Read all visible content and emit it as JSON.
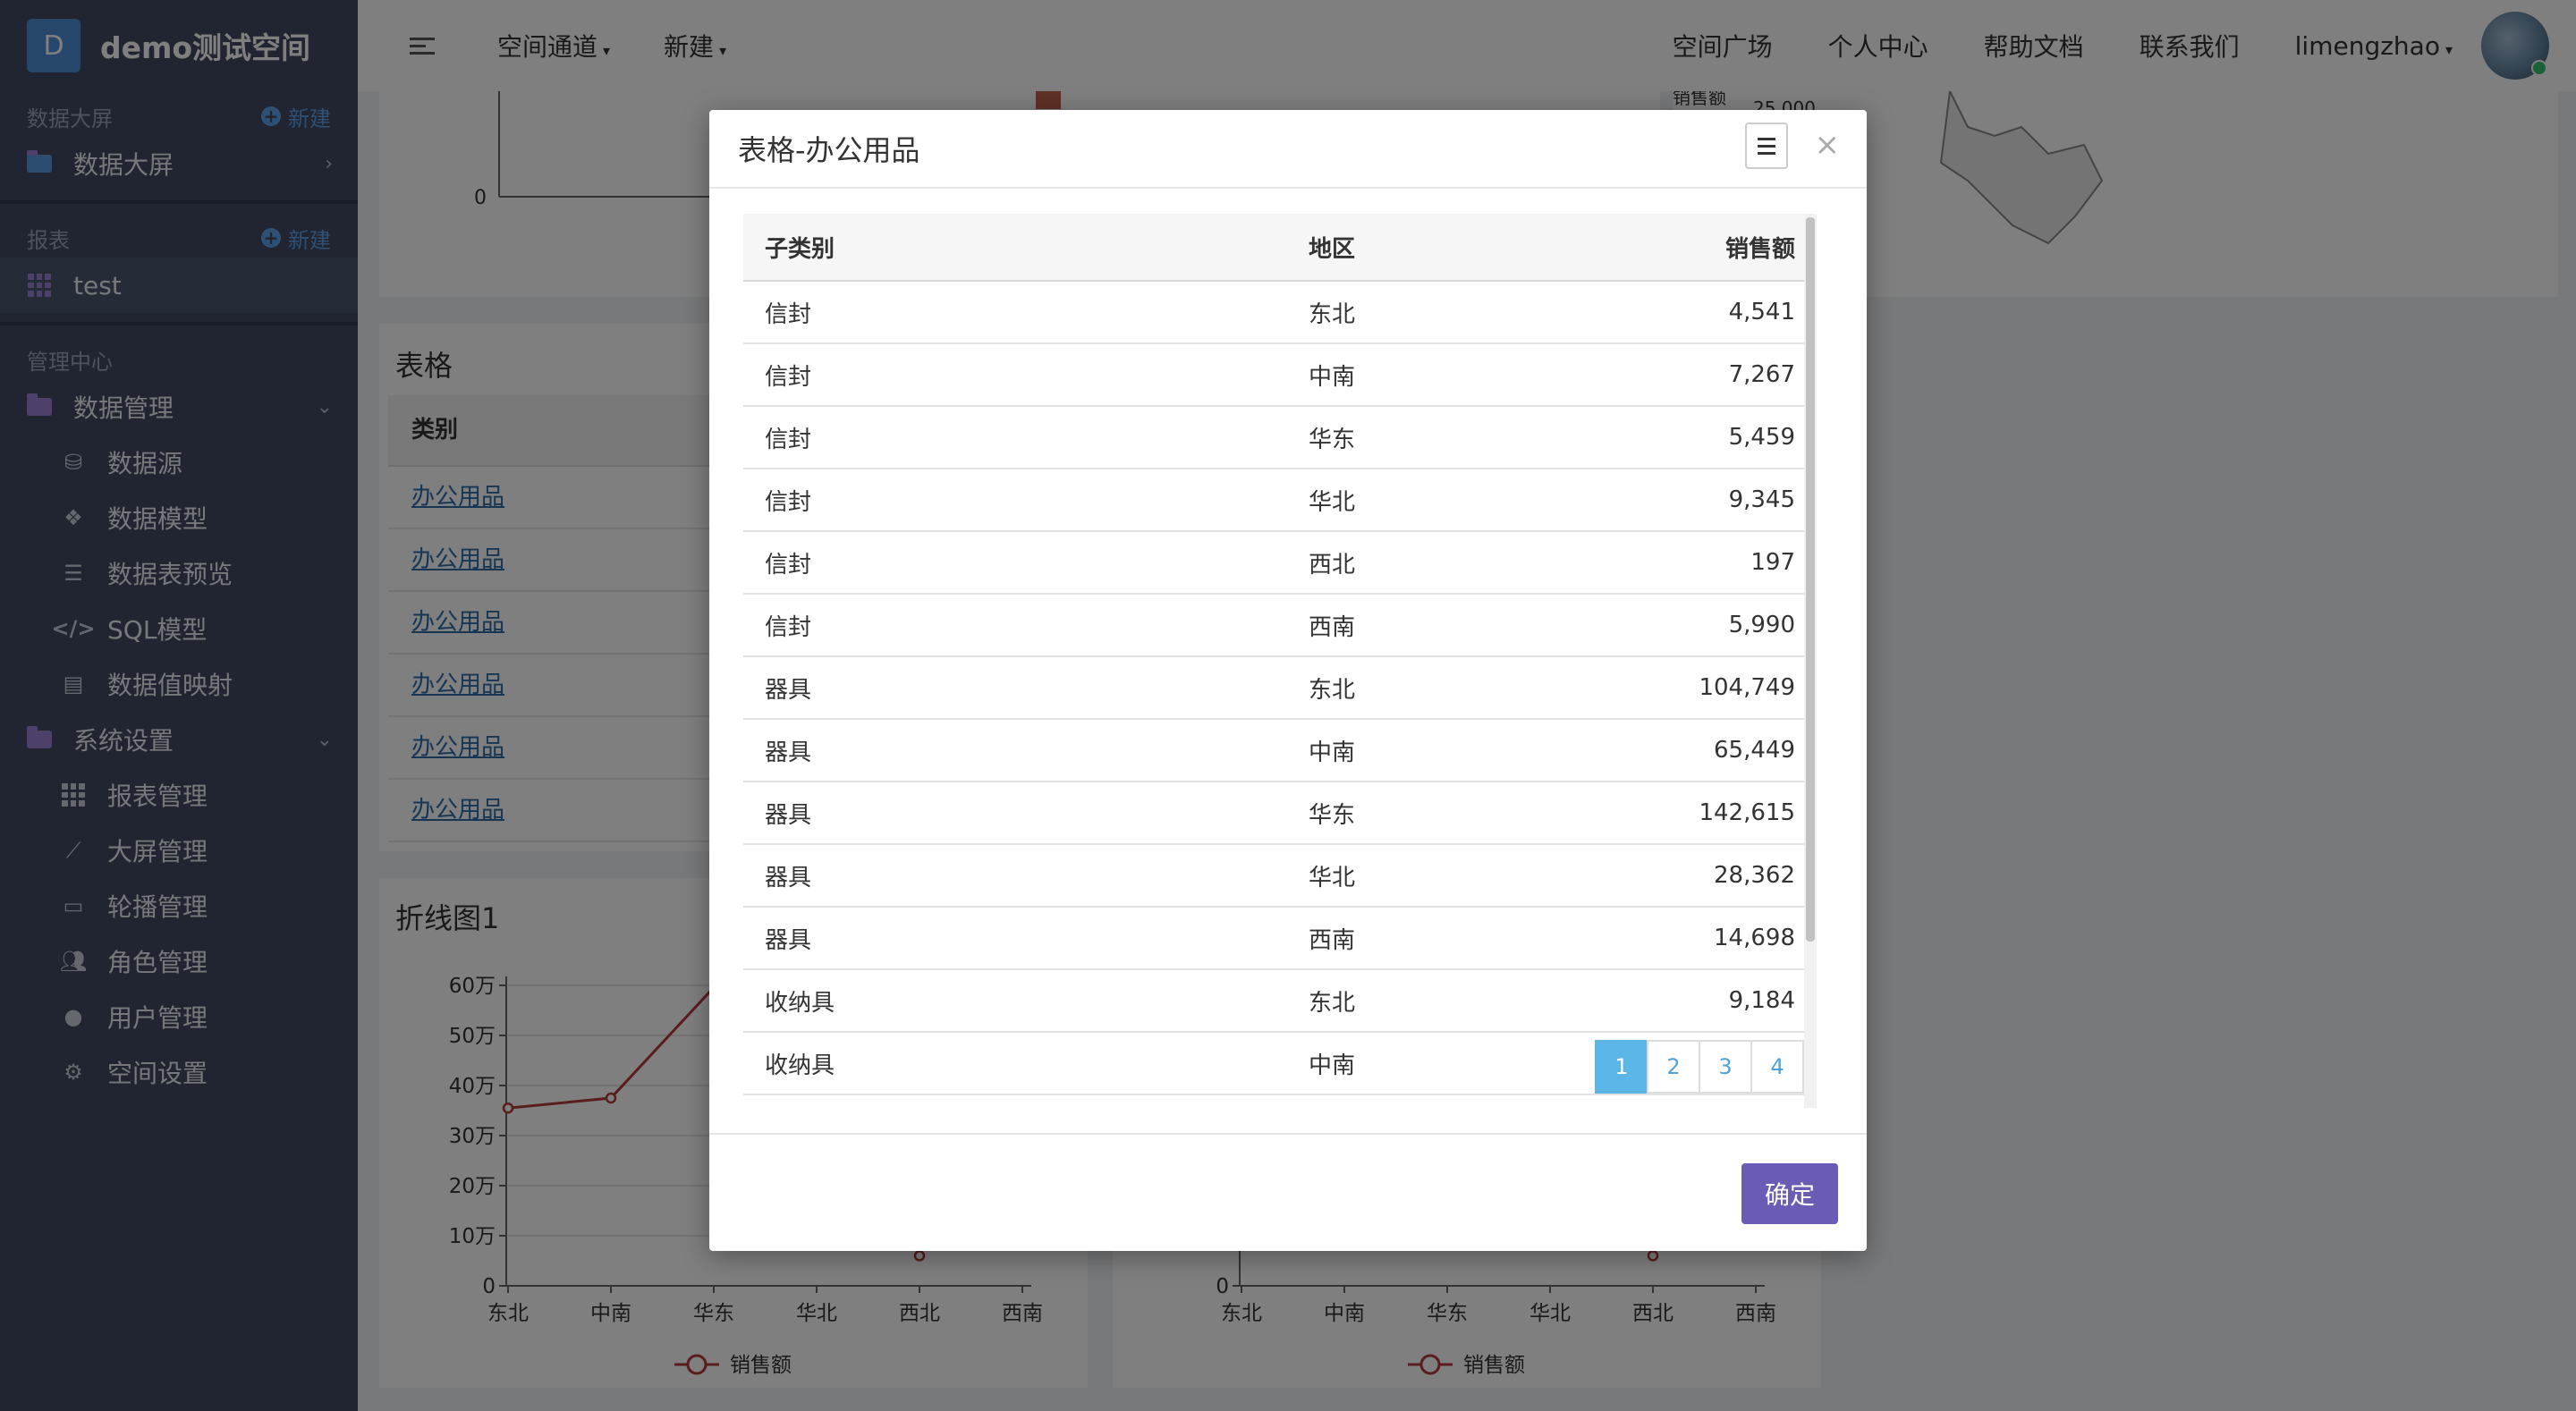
{
  "brand": {
    "logo_letter": "D",
    "name": "demo测试空间"
  },
  "sidebar": {
    "section_dashboard": {
      "label": "数据大屏",
      "new": "新建"
    },
    "dashboard_item": "数据大屏",
    "section_reports": {
      "label": "报表",
      "new": "新建"
    },
    "report_item": "test",
    "section_admin": {
      "label": "管理中心"
    },
    "data_mgmt": {
      "label": "数据管理",
      "children": [
        "数据源",
        "数据模型",
        "数据表预览",
        "SQL模型",
        "数据值映射"
      ]
    },
    "sys_settings": {
      "label": "系统设置",
      "children": [
        "报表管理",
        "大屏管理",
        "轮播管理",
        "角色管理",
        "用户管理",
        "空间设置"
      ]
    }
  },
  "topbar": {
    "menus": [
      "空间通道",
      "新建"
    ],
    "right_links": [
      "空间广场",
      "个人中心",
      "帮助文档",
      "联系我们"
    ],
    "username": "limengzhao"
  },
  "background": {
    "table_panel": {
      "title": "表格",
      "header": "类别",
      "rows": [
        "办公用品",
        "办公用品",
        "办公用品",
        "办公用品",
        "办公用品",
        "办公用品"
      ]
    },
    "line_chart_1": {
      "title": "折线图1",
      "legend": "销售额"
    },
    "line_chart_2": {
      "legend": "销售额"
    },
    "top_left_axis_zero": "0",
    "top_right_label": "销售额",
    "top_right_tick": "25,000"
  },
  "chart_data": [
    {
      "type": "line",
      "title": "折线图1",
      "categories": [
        "东北",
        "中南",
        "华东",
        "华北",
        "西北",
        "西南"
      ],
      "y_ticks": [
        "0",
        "10万",
        "20万",
        "30万",
        "40万",
        "50万",
        "60万"
      ],
      "ylim": [
        0,
        600000
      ],
      "series": [
        {
          "name": "销售额",
          "values": [
            355000,
            375000,
            null,
            null,
            60000,
            null
          ]
        }
      ]
    },
    {
      "type": "line",
      "categories": [
        "东北",
        "中南",
        "华东",
        "华北",
        "西北",
        "西南"
      ],
      "y_ticks": [
        "0"
      ],
      "series": [
        {
          "name": "销售额",
          "values": [
            null,
            null,
            null,
            null,
            60000,
            null
          ]
        }
      ]
    }
  ],
  "modal": {
    "title": "表格-办公用品",
    "columns": [
      "子类别",
      "地区",
      "销售额"
    ],
    "rows": [
      [
        "信封",
        "东北",
        "4,541"
      ],
      [
        "信封",
        "中南",
        "7,267"
      ],
      [
        "信封",
        "华东",
        "5,459"
      ],
      [
        "信封",
        "华北",
        "9,345"
      ],
      [
        "信封",
        "西北",
        "197"
      ],
      [
        "信封",
        "西南",
        "5,990"
      ],
      [
        "器具",
        "东北",
        "104,749"
      ],
      [
        "器具",
        "中南",
        "65,449"
      ],
      [
        "器具",
        "华东",
        "142,615"
      ],
      [
        "器具",
        "华北",
        "28,362"
      ],
      [
        "器具",
        "西南",
        "14,698"
      ],
      [
        "收纳具",
        "东北",
        "9,184"
      ],
      [
        "收纳具",
        "中南",
        ""
      ]
    ],
    "pages": [
      "1",
      "2",
      "3",
      "4"
    ],
    "current_page": "1",
    "ok_label": "确定"
  }
}
